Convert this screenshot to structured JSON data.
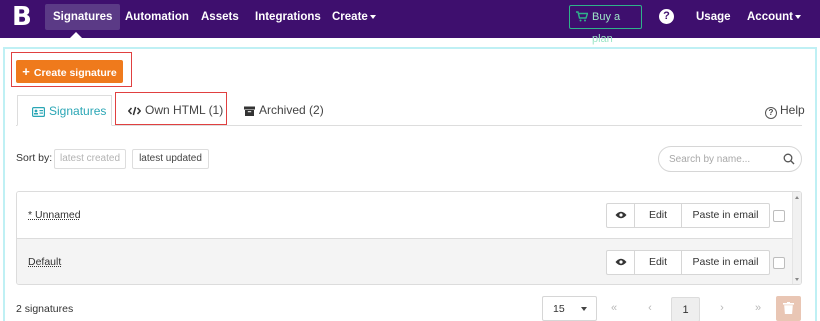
{
  "nav": {
    "logo": "B",
    "items": [
      {
        "label": "Signatures"
      },
      {
        "label": "Automation"
      },
      {
        "label": "Assets"
      },
      {
        "label": "Integrations"
      },
      {
        "label": "Create"
      }
    ],
    "buy_label": "Buy a plan",
    "usage_label": "Usage",
    "account_label": "Account"
  },
  "toolbar": {
    "create_label": "Create signature"
  },
  "tabs": [
    {
      "label": "Signatures"
    },
    {
      "label": "Own HTML (1)"
    },
    {
      "label": "Archived (2)"
    }
  ],
  "help_label": "Help",
  "sort": {
    "label": "Sort by:",
    "options": [
      "latest created",
      "latest updated"
    ]
  },
  "search": {
    "placeholder": "Search by name..."
  },
  "rows": [
    {
      "name": "* Unnamed",
      "edit": "Edit",
      "paste": "Paste in email"
    },
    {
      "name": "Default",
      "edit": "Edit",
      "paste": "Paste in email"
    }
  ],
  "footer": {
    "count": "2 signatures",
    "per_page": "15",
    "first": "«",
    "prev": "‹",
    "page": "1",
    "next": "›",
    "last": "»"
  },
  "colors": {
    "nav_bg": "#3e0f6e",
    "accent": "#ef7a1c",
    "tab_active": "#2aa6b5",
    "highlight_box": "#e04040"
  }
}
